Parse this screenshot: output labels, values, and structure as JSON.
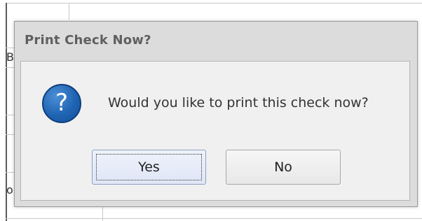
{
  "dialog": {
    "title": "Print Check Now?",
    "message": "Would you like to print this check now?",
    "icon": "question-icon",
    "buttons": {
      "yes_label": "Yes",
      "no_label": "No",
      "default": "Yes"
    }
  },
  "background": {
    "fragment_1": "Bo",
    "fragment_2": "o"
  },
  "colors": {
    "icon_blue": "#1f64b3",
    "dialog_bg": "#dcdcdc",
    "body_bg": "#f0f0f0",
    "title_text": "#5f5f5f",
    "yes_button_bg": "#dfe6f6"
  }
}
